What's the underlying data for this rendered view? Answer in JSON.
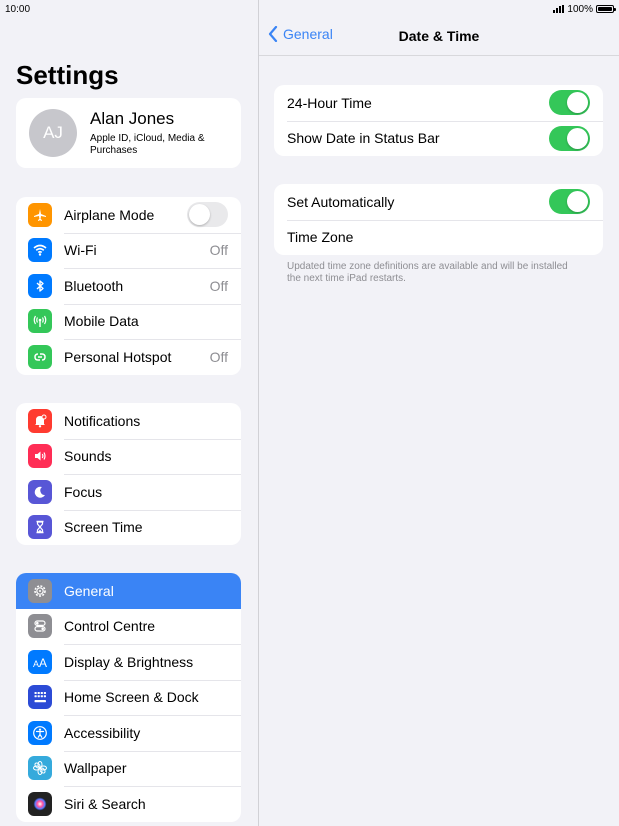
{
  "status_bar": {
    "time": "10:00",
    "battery": "100%"
  },
  "settings": {
    "title": "Settings",
    "profile": {
      "initials": "AJ",
      "name": "Alan Jones",
      "subtitle": "Apple ID, iCloud, Media & Purchases"
    },
    "group1": [
      {
        "label": "Airplane Mode",
        "icon": "airplane-icon",
        "color": "#ff9500",
        "toggle": false
      },
      {
        "label": "Wi-Fi",
        "icon": "wifi-icon",
        "color": "#007aff",
        "value": "Off"
      },
      {
        "label": "Bluetooth",
        "icon": "bluetooth-icon",
        "color": "#007aff",
        "value": "Off"
      },
      {
        "label": "Mobile Data",
        "icon": "antenna-icon",
        "color": "#34c759"
      },
      {
        "label": "Personal Hotspot",
        "icon": "hotspot-icon",
        "color": "#34c759",
        "value": "Off"
      }
    ],
    "group2": [
      {
        "label": "Notifications",
        "icon": "bell-icon",
        "color": "#ff3b30"
      },
      {
        "label": "Sounds",
        "icon": "speaker-icon",
        "color": "#ff2d55"
      },
      {
        "label": "Focus",
        "icon": "moon-icon",
        "color": "#5856d6"
      },
      {
        "label": "Screen Time",
        "icon": "hourglass-icon",
        "color": "#5856d6"
      }
    ],
    "group3": [
      {
        "label": "General",
        "icon": "gear-icon",
        "color": "#8e8e93",
        "selected": true
      },
      {
        "label": "Control Centre",
        "icon": "switches-icon",
        "color": "#8e8e93"
      },
      {
        "label": "Display & Brightness",
        "icon": "text-size-icon",
        "color": "#007aff"
      },
      {
        "label": "Home Screen & Dock",
        "icon": "grid-icon",
        "color": "#2c4bd6"
      },
      {
        "label": "Accessibility",
        "icon": "accessibility-icon",
        "color": "#007aff"
      },
      {
        "label": "Wallpaper",
        "icon": "flower-icon",
        "color": "#35aadc"
      },
      {
        "label": "Siri & Search",
        "icon": "siri-icon",
        "color": "#222222"
      }
    ]
  },
  "detail": {
    "back_label": "General",
    "title": "Date & Time",
    "group1": [
      {
        "label": "24-Hour Time",
        "toggle": true
      },
      {
        "label": "Show Date in Status Bar",
        "toggle": true
      }
    ],
    "group2": [
      {
        "label": "Set Automatically",
        "toggle": true
      },
      {
        "label": "Time Zone"
      }
    ],
    "note": "Updated time zone definitions are available and will be installed the next time iPad restarts."
  },
  "colors": {
    "accent": "#3a84f5",
    "toggle_on": "#34c759",
    "toggle_off": "#e9e9eb"
  }
}
